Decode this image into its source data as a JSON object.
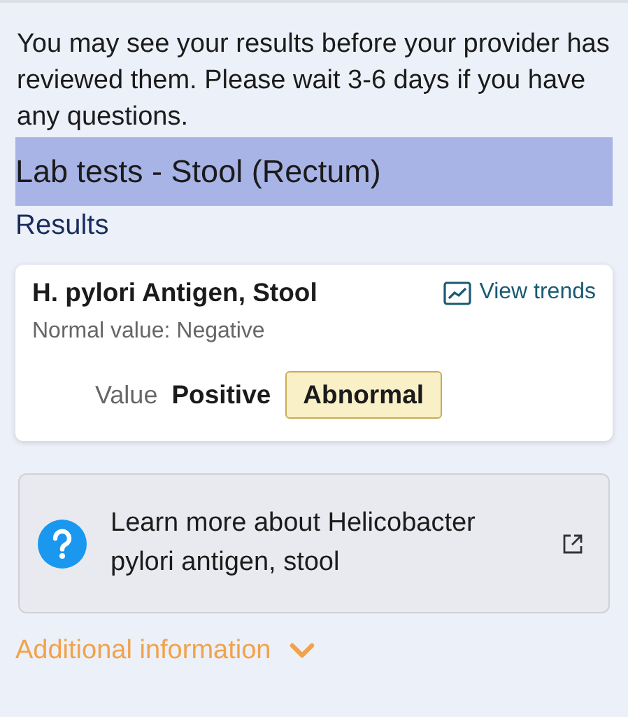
{
  "notice": "You may see your results before your provider has reviewed them. Please wait 3-6 days if you have any questions.",
  "heading": {
    "title": "Lab tests - Stool (Rectum)",
    "highlighted": true
  },
  "section_label": "Results",
  "result": {
    "name": "H. pylori Antigen, Stool",
    "trends_link": "View trends",
    "normal_value": "Normal value: Negative",
    "value_label": "Value",
    "value": "Positive",
    "flag": {
      "text": "Abnormal",
      "kind": "abnormal"
    }
  },
  "learn_more": {
    "text": "Learn more about Helicobacter pylori antigen, stool"
  },
  "additional_info": {
    "label": "Additional information",
    "expanded": false
  }
}
